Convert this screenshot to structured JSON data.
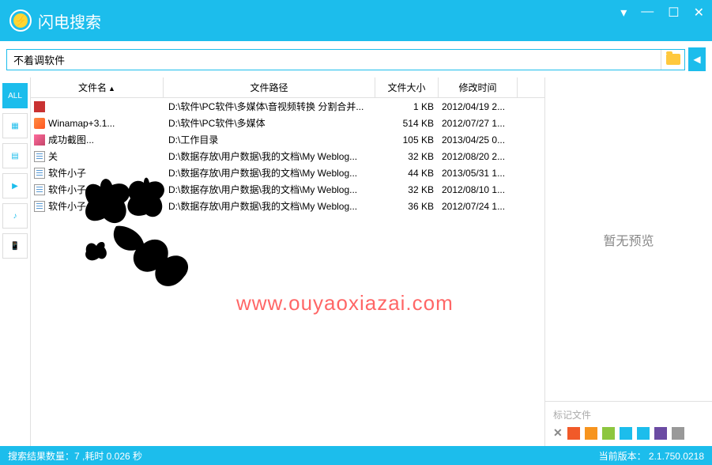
{
  "app": {
    "title": "闪电搜索"
  },
  "search": {
    "value": "不着调软件"
  },
  "sidebar": [
    {
      "label": "ALL",
      "name": "filter-all",
      "active": true
    },
    {
      "label": "▦",
      "name": "filter-images"
    },
    {
      "label": "▤",
      "name": "filter-docs"
    },
    {
      "label": "▶",
      "name": "filter-video"
    },
    {
      "label": "♪",
      "name": "filter-audio"
    },
    {
      "label": "📱",
      "name": "filter-mobile"
    }
  ],
  "columns": {
    "name": "文件名",
    "path": "文件路径",
    "size": "文件大小",
    "date": "修改时间"
  },
  "rows": [
    {
      "ico": "ico-red",
      "name": "",
      "path": "D:\\软件\\PC软件\\多媒体\\音视频转换 分割合并...",
      "size": "1 KB",
      "date": "2012/04/19 2..."
    },
    {
      "ico": "ico-cat",
      "name": "Winamap+3.1...",
      "path": "D:\\软件\\PC软件\\多媒体",
      "size": "514 KB",
      "date": "2012/07/27 1..."
    },
    {
      "ico": "ico-img",
      "name": "成功截图...",
      "path": "D:\\工作目录",
      "size": "105 KB",
      "date": "2013/04/25 0..."
    },
    {
      "ico": "ico-doc",
      "name": "关",
      "path": "D:\\数据存放\\用户数据\\我的文档\\My Weblog...",
      "size": "32 KB",
      "date": "2012/08/20 2..."
    },
    {
      "ico": "ico-doc",
      "name": "软件小子",
      "path": "D:\\数据存放\\用户数据\\我的文档\\My Weblog...",
      "size": "44 KB",
      "date": "2013/05/31 1..."
    },
    {
      "ico": "ico-doc",
      "name": "软件小子 (",
      "path": "D:\\数据存放\\用户数据\\我的文档\\My Weblog...",
      "size": "32 KB",
      "date": "2012/08/10 1..."
    },
    {
      "ico": "ico-doc",
      "name": "软件小子（    件）",
      "path": "D:\\数据存放\\用户数据\\我的文档\\My Weblog...",
      "size": "36 KB",
      "date": "2012/07/24 1..."
    }
  ],
  "preview": {
    "empty": "暂无预览",
    "tagsTitle": "标记文件"
  },
  "tags": [
    "#f15a29",
    "#f7941e",
    "#8dc63f",
    "#1cbdec",
    "#1cbdec",
    "#6b4ba3",
    "#999"
  ],
  "status": {
    "left": "搜索结果数量：7 ,耗时 0.026 秒",
    "right": "当前版本：  2.1.750.0218"
  },
  "watermark": "www.ouyaoxiazai.com"
}
